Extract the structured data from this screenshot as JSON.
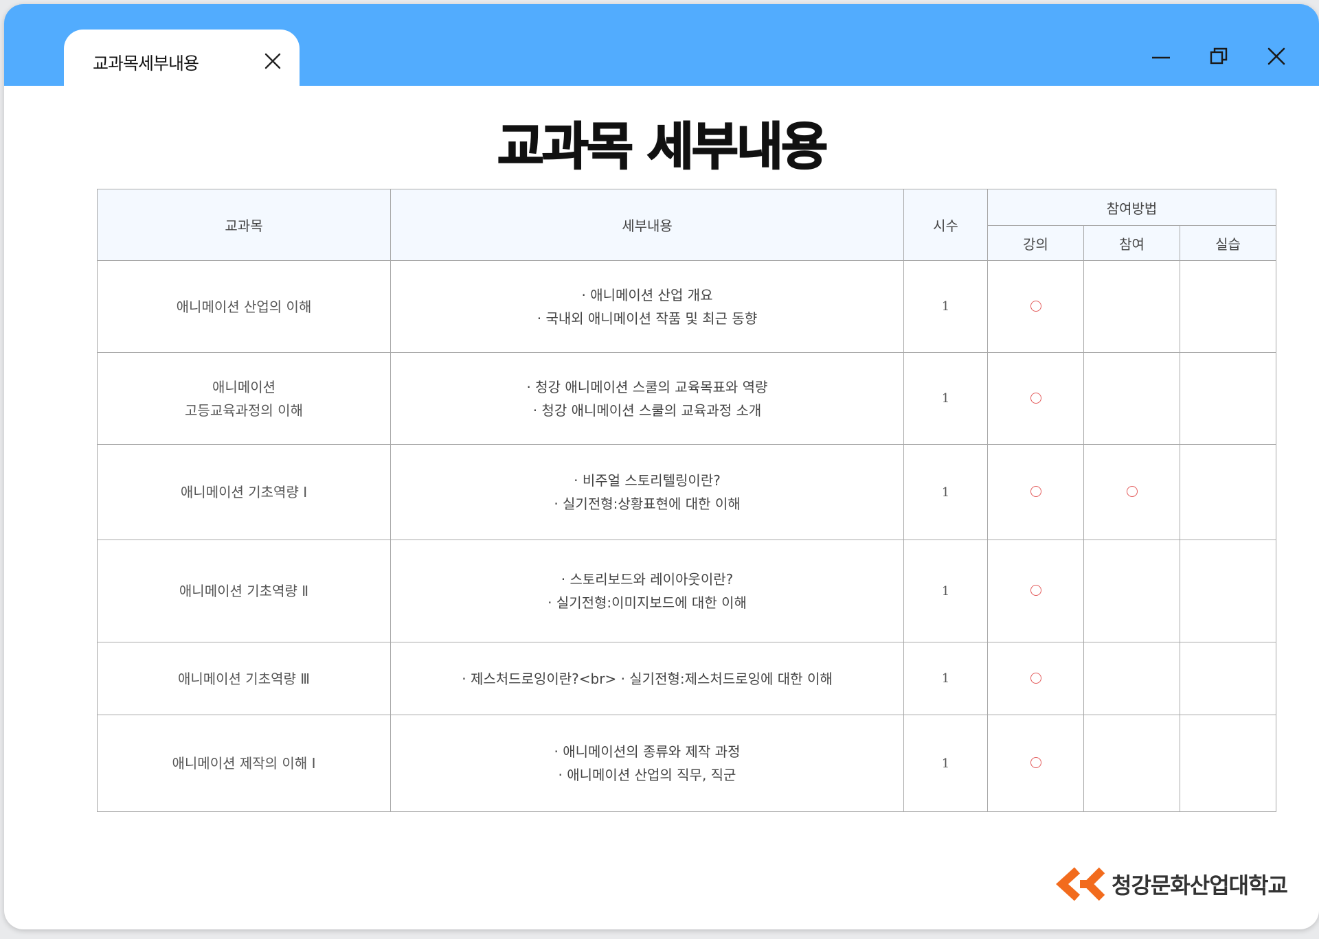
{
  "tab": {
    "label": "교과목세부내용"
  },
  "page": {
    "title": "교과목 세부내용"
  },
  "table": {
    "headers": {
      "subject": "교과목",
      "detail": "세부내용",
      "hours": "시수",
      "method_group": "참여방법",
      "methods": [
        "강의",
        "참여",
        "실습"
      ]
    },
    "rows": [
      {
        "subject": "애니메이션 산업의 이해",
        "details": [
          "· 애니메이션 산업 개요",
          "· 국내외 애니메이션 작품 및 최근 동향"
        ],
        "hours": "1",
        "marks": [
          true,
          false,
          false
        ]
      },
      {
        "subject": "애니메이션\n고등교육과정의 이해",
        "details": [
          "· 청강 애니메이션 스쿨의 교육목표와 역량",
          "· 청강 애니메이션 스쿨의 교육과정 소개"
        ],
        "hours": "1",
        "marks": [
          true,
          false,
          false
        ]
      },
      {
        "subject": "애니메이션 기초역량 Ⅰ",
        "details": [
          "· 비주얼 스토리텔링이란?",
          "· 실기전형:상황표현에 대한 이해"
        ],
        "hours": "1",
        "marks": [
          true,
          true,
          false
        ]
      },
      {
        "subject": "애니메이션 기초역량 Ⅱ",
        "details": [
          "· 스토리보드와 레이아웃이란?",
          "· 실기전형:이미지보드에 대한 이해"
        ],
        "hours": "1",
        "marks": [
          true,
          false,
          false
        ]
      },
      {
        "subject": "애니메이션 기초역량 Ⅲ",
        "details": [
          "· 제스처드로잉이란?<br> · 실기전형:제스처드로잉에 대한 이해"
        ],
        "hours": "1",
        "marks": [
          true,
          false,
          false
        ]
      },
      {
        "subject": "애니메이션 제작의 이해 Ⅰ",
        "details": [
          "· 애니메이션의 종류와 제작 과정",
          "· 애니메이션 산업의 직무, 직군"
        ],
        "hours": "1",
        "marks": [
          true,
          false,
          false
        ]
      }
    ],
    "row_heights": [
      134,
      134,
      139,
      149,
      106,
      141
    ]
  },
  "logo": {
    "text": "청강문화산업대학교"
  },
  "colors": {
    "titlebar": "#52acfe",
    "circle_mark": "#e35a5a",
    "logo_orange": "#f26b1d"
  },
  "icons": {
    "tab_close": "close-icon",
    "minimize": "minimize-icon",
    "maximize": "restore-icon",
    "close": "close-icon"
  }
}
